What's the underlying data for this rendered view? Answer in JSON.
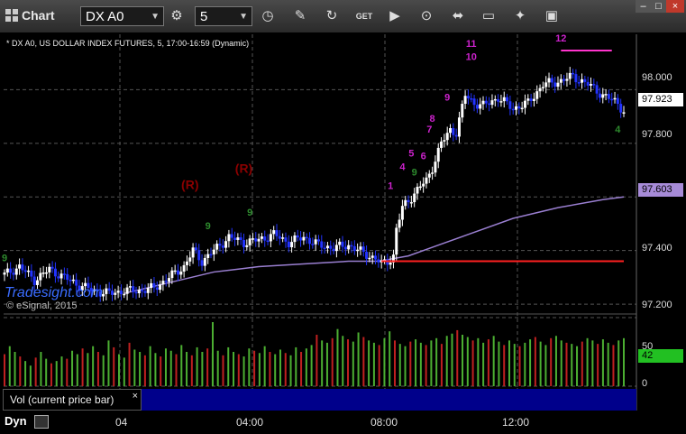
{
  "toolbar": {
    "title": "Chart",
    "symbol": "DX A0",
    "interval": "5",
    "icons": [
      "settings-icon",
      "clock-icon",
      "pencil-icon",
      "refresh-icon",
      "get-icon",
      "play-icon",
      "link-icon",
      "comment-icon",
      "twitter-icon",
      "save-icon"
    ]
  },
  "window_controls": [
    "–",
    "□",
    "×"
  ],
  "header": "* DX A0, US DOLLAR INDEX FUTURES, 5, 17:00-16:59 (Dynamic)",
  "watermark": "Tradesight.com",
  "copyright": "© eSignal, 2015",
  "volume_panel_label": "Vol (current price bar)",
  "volume_panel_close": "×",
  "interval_mode": "Dyn",
  "colors": {
    "up_candle": "#ffffff",
    "down_candle": "#2233ff",
    "moving_average": "#9a7fd1",
    "support_line": "#ff2020",
    "resistance_line": "#ff33cc",
    "volume_up": "#4caf32",
    "volume_down": "#c02020",
    "setup_count": "#cc22cc",
    "countdown": "#2e8b2e",
    "reversal_marker": "#8b0000",
    "last_price_flag": "#ffffff",
    "ma_flag": "#a78bd8",
    "volume_flag": "#22c022"
  },
  "chart_data": {
    "type": "candlestick",
    "symbol": "DX A0",
    "ylim": [
      97.17,
      98.2
    ],
    "y_ticks": [
      "98.000",
      "97.800",
      "97.400",
      "97.200"
    ],
    "x_ticks": [
      "04",
      "04:00",
      "08:00",
      "12:00"
    ],
    "last_price": "97.923",
    "moving_average_value": "97.603",
    "support_level": 97.36,
    "volume_ticks": [
      "50",
      "0"
    ],
    "volume_last": "42",
    "price_path": [
      [
        0,
        97.31
      ],
      [
        5,
        97.34
      ],
      [
        10,
        97.29
      ],
      [
        15,
        97.33
      ],
      [
        20,
        97.3
      ],
      [
        25,
        97.27
      ],
      [
        30,
        97.25
      ],
      [
        35,
        97.24
      ],
      [
        40,
        97.25
      ],
      [
        45,
        97.25
      ],
      [
        50,
        97.26
      ],
      [
        55,
        97.3
      ],
      [
        60,
        97.34
      ],
      [
        63,
        97.4
      ],
      [
        66,
        97.36
      ],
      [
        70,
        97.4
      ],
      [
        75,
        97.45
      ],
      [
        80,
        97.43
      ],
      [
        85,
        97.44
      ],
      [
        90,
        97.46
      ],
      [
        95,
        97.43
      ],
      [
        100,
        97.45
      ],
      [
        105,
        97.42
      ],
      [
        110,
        97.41
      ],
      [
        115,
        97.42
      ],
      [
        120,
        97.39
      ],
      [
        124,
        97.37
      ],
      [
        126,
        97.35
      ],
      [
        128,
        97.36
      ],
      [
        130,
        97.38
      ],
      [
        131,
        97.48
      ],
      [
        133,
        97.56
      ],
      [
        136,
        97.6
      ],
      [
        139,
        97.64
      ],
      [
        141,
        97.66
      ],
      [
        143,
        97.71
      ],
      [
        146,
        97.8
      ],
      [
        149,
        97.85
      ],
      [
        151,
        97.84
      ],
      [
        154,
        97.98
      ],
      [
        157,
        97.95
      ],
      [
        160,
        97.94
      ],
      [
        165,
        97.97
      ],
      [
        170,
        97.93
      ],
      [
        175,
        97.95
      ],
      [
        180,
        98.02
      ],
      [
        185,
        98.03
      ],
      [
        190,
        98.05
      ],
      [
        195,
        98.02
      ],
      [
        200,
        97.98
      ],
      [
        205,
        97.95
      ],
      [
        207,
        97.92
      ]
    ],
    "ma_path": [
      [
        40,
        97.24
      ],
      [
        55,
        97.28
      ],
      [
        70,
        97.32
      ],
      [
        85,
        97.34
      ],
      [
        100,
        97.35
      ],
      [
        115,
        97.36
      ],
      [
        125,
        97.36
      ],
      [
        135,
        97.38
      ],
      [
        145,
        97.42
      ],
      [
        155,
        97.46
      ],
      [
        170,
        97.52
      ],
      [
        185,
        97.56
      ],
      [
        200,
        97.59
      ],
      [
        207,
        97.6
      ]
    ],
    "volume_range": [
      0,
      60
    ],
    "volume": [
      28,
      35,
      30,
      26,
      22,
      18,
      25,
      30,
      24,
      20,
      22,
      26,
      24,
      31,
      28,
      33,
      29,
      35,
      30,
      27,
      40,
      34,
      28,
      25,
      38,
      32,
      30,
      27,
      35,
      29,
      26,
      33,
      31,
      28,
      36,
      30,
      27,
      34,
      30,
      33,
      29,
      31,
      27,
      34,
      30,
      28,
      26,
      33,
      31,
      29,
      35,
      30,
      28,
      32,
      29,
      27,
      34,
      30,
      33,
      36,
      45,
      40,
      38,
      42,
      50,
      44,
      41,
      39,
      47,
      43,
      40,
      38,
      36,
      42,
      48,
      40,
      37,
      35,
      39,
      41,
      38,
      36,
      40,
      42,
      37,
      44,
      46,
      49,
      45,
      43,
      40,
      42,
      38,
      41,
      44,
      39,
      36,
      40,
      37,
      35,
      38,
      41,
      43,
      39,
      36,
      42,
      44,
      40,
      38,
      37,
      35,
      39,
      42,
      40,
      37,
      41,
      38,
      36,
      40,
      42
    ],
    "annotations": [
      {
        "text": "(R)",
        "x": 62,
        "y": 97.63,
        "kind": "reversal"
      },
      {
        "text": "(R)",
        "x": 80,
        "y": 97.69,
        "kind": "reversal"
      },
      {
        "text": "1",
        "x": 129,
        "y": 97.63,
        "kind": "setup"
      },
      {
        "text": "4",
        "x": 133,
        "y": 97.7,
        "kind": "setup"
      },
      {
        "text": "5",
        "x": 136,
        "y": 97.75,
        "kind": "setup"
      },
      {
        "text": "6",
        "x": 140,
        "y": 97.74,
        "kind": "setup"
      },
      {
        "text": "7",
        "x": 142,
        "y": 97.84,
        "kind": "setup"
      },
      {
        "text": "8",
        "x": 143,
        "y": 97.88,
        "kind": "setup"
      },
      {
        "text": "9",
        "x": 148,
        "y": 97.96,
        "kind": "setup"
      },
      {
        "text": "10",
        "x": 156,
        "y": 98.11,
        "kind": "setup"
      },
      {
        "text": "11",
        "x": 156,
        "y": 98.16,
        "kind": "setup"
      },
      {
        "text": "12",
        "x": 186,
        "y": 98.18,
        "kind": "setup"
      },
      {
        "text": "9",
        "x": 0,
        "y": 97.36,
        "kind": "countdown"
      },
      {
        "text": "9",
        "x": 68,
        "y": 97.48,
        "kind": "countdown"
      },
      {
        "text": "9",
        "x": 82,
        "y": 97.53,
        "kind": "countdown"
      },
      {
        "text": "9",
        "x": 137,
        "y": 97.68,
        "kind": "countdown"
      },
      {
        "text": "4",
        "x": 205,
        "y": 97.84,
        "kind": "countdown"
      }
    ]
  }
}
